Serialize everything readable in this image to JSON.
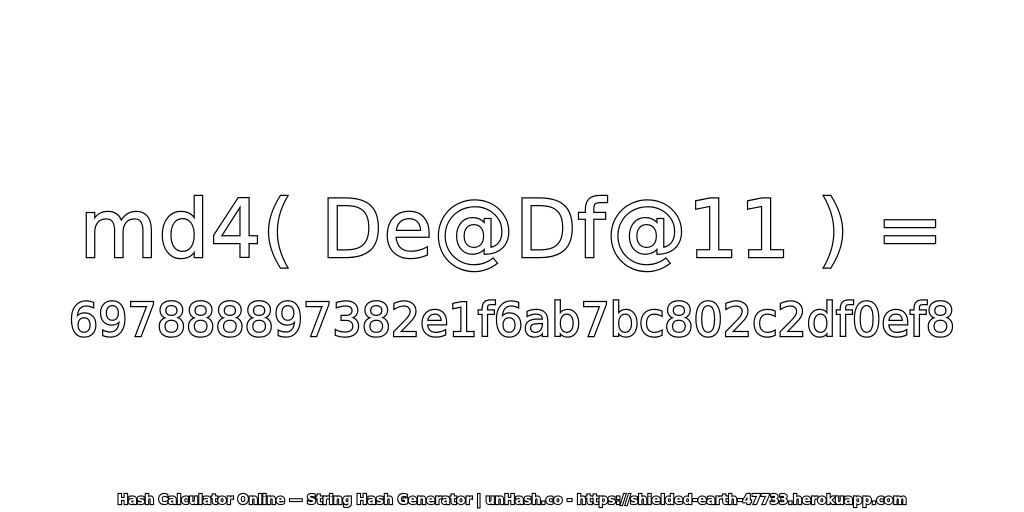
{
  "main": {
    "expression": "md4( De@Df@11 ) =",
    "hash": "697888897382e1f6ab7bc802c2df0ef8"
  },
  "footer": {
    "text": "Hash Calculator Online — String Hash Generator | unHash.co - https://shielded-earth-47733.herokuapp.com"
  },
  "colors": {
    "background": "#ffffff",
    "outline": "#000000",
    "fill": "#ffffff"
  }
}
